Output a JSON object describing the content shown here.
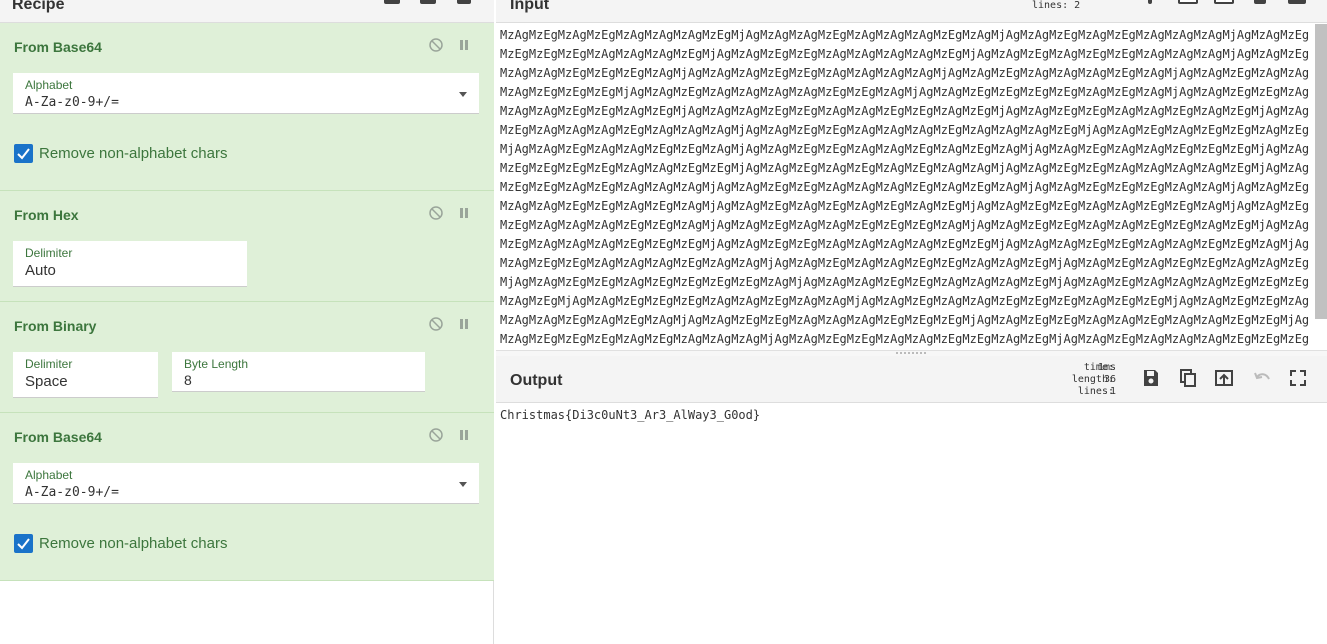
{
  "recipe": {
    "title": "Recipe",
    "operations": [
      {
        "name": "From Base64",
        "alphabet_label": "Alphabet",
        "alphabet_value": "A-Za-z0-9+/=",
        "checkbox_label": "Remove non-alphabet chars"
      },
      {
        "name": "From Hex",
        "delimiter_label": "Delimiter",
        "delimiter_value": "Auto"
      },
      {
        "name": "From Binary",
        "delimiter_label": "Delimiter",
        "delimiter_value": "Space",
        "byte_length_label": "Byte Length",
        "byte_length_value": "8"
      },
      {
        "name": "From Base64",
        "alphabet_label": "Alphabet",
        "alphabet_value": "A-Za-z0-9+/=",
        "checkbox_label": "Remove non-alphabet chars"
      }
    ]
  },
  "input": {
    "title": "Input",
    "stats": "lines:   2",
    "text": "MzAgMzEgMzAgMzEgMzAgMzAgMzAgMzEgMjAgMzAgMzAgMzEgMzAgMzAgMzAgMzEgMzAgMjAgMzAgMzEgMzAgMzEgMzAgMzAgMzAgMjAgMzAgMzEgMzEgMzEgMzEgMzAgMzAgMzAgMzEgMjAgMzAgMzEgMzEgMzAgMzAgMzAgMzAgMzEgMjAgMzAgMzEgMzAgMzEgMzEgMzAgMzAgMzAgMjAgMzAgMzEgMzAgMzAgMzEgMzEgMzEgMzAgMjAgMzAgMzAgMzEgMzEgMzAgMzAgMzAgMzAgMjAgMzAgMzEgMzAgMzAgMzAgMzEgMzAgMjAgMzAgMzEgMzAgMzAgMzAgMzEgMzEgMzEgMjAgMzAgMzEgMzAgMzAgMzAgMzAgMzEgMzEgMzAgMjAgMzAgMzEgMzEgMzEgMzEgMzAgMzEgMzAgMjAgMzAgMzEgMzEgMzAgMzAgMzAgMzEgMzEgMzAgMzEgMjAgMzAgMzAgMzEgMzEgMzAgMzAgMzEgMzEgMzAgMzEgMjAgMzAgMzEgMzEgMzAgMzAgMzEgMzAgMzEgMjAgMzAgMzEgMzAgMzAgMzAgMzEgMzAgMzAgMzAgMjAgMzAgMzEgMzEgMzAgMzAgMzAgMzEgMzAgMzAgMzAgMzEgMjAgMzAgMzEgMzAgMzEgMzEgMzAgMzEgMjAgMzAgMzEgMzAgMzAgMzEgMzEgMzAgMjAgMzAgMzEgMzEgMzAgMzAgMzEgMzAgMzEgMzAgMjAgMzAgMzEgMzAgMzAgMzEgMzEgMzEgMjAgMzAgMzEgMzEgMzEgMzEgMzAgMzAgMzEgMzEgMjAgMzAgMzEgMzAgMzEgMzAgMzEgMzAgMzAgMjAgMzAgMzEgMzEgMzAgMzAgMzAgMzAgMzEgMjAgMzAgMzEgMzEgMzAgMzEgMzAgMzAgMzAgMjAgMzAgMzEgMzEgMzAgMzAgMzAgMzEgMzAgMzEgMzAgMjAgMzAgMzEgMzEgMzEgMzAgMzAgMjAgMzAgMzEgMzAgMzAgMzEgMzEgMzAgMzEgMzAgMjAgMzAgMzEgMzAgMzEgMzAgMzEgMzAgMzEgMjAgMzAgMzEgMzEgMzAgMzAgMzEgMzEgMzAgMjAgMzAgMzEgMzEgMzAgMzAgMzAgMzEgMzEgMzAgMjAgMzAgMzEgMzAgMzAgMzEgMzEgMzEgMzAgMjAgMzAgMzEgMzEgMzAgMzAgMzEgMzEgMzAgMzEgMjAgMzAgMzEgMzAgMzAgMzAgMzEgMzEgMzEgMjAgMzAgMzEgMzEgMzAgMzAgMzAgMzAgMzEgMzEgMjAgMzAgMzAgMzEgMzEgMzAgMzAgMzEgMzEgMzAgMjAgMzAgMzEgMzEgMzAgMzAgMzAgMzEgMzAgMzAgMjAgMzAgMzEgMzAgMzAgMzEgMzEgMzAgMzAgMzEgMjAgMzAgMzEgMzAgMzEgMzEgMzAgMzAgMzEgMjAgMzAgMzEgMzEgMzAgMzEgMzEgMzEgMzEgMzAgMjAgMzAgMzAgMzEgMzEgMzAgMzAgMzAgMzEgMjAgMzAgMzEgMzAgMzAgMzAgMzEgMzEgMzEgMzAgMzEgMjAgMzAgMzEgMzEgMzEgMzAgMzAgMzEgMzAgMzAgMjAgMzAgMzEgMzAgMzAgMzEgMzEgMzEgMzAgMzEgMzEgMjAgMzAgMzEgMzEgMzAgMzAgMzAgMzEgMzAgMzEgMzAgMjAgMzAgMzEgMzEgMzAgMzAgMzAgMzEgMzEgMzEgMjAgMzAgMzEgMzEgMzAgMzAgMzEgMzAgMzAgMzEgMzEgMjAgMzAgMzEgMzEgMzEgMzAgMzEgMzAgMzAgMzAgMjAgMzAgMzEgMzEgMzAgMzAgMzEgMzEgMzAgMzEgMjAgMzAgMzEgMzAgMzAgMzAgMzEgMzEgMzEgMzAgMjAgMzAgMzEgMzEgMzAgMzAgMzAgMzEgMzEgMzAgMzEgMjAgMzAgMzEgMzAgMzAgMzEgMzEgMzEgMzAgMzAgMjAgMzAgMzEgMzEgMzAgMzAgMzEgMzAgMzAgMzEgMzAgMjAgMzAgMzEgMzEgMzEgMzAgMzEgMzEgMzAgMzAgMjAgMzAgMzEgMzAgMzAgMzEgMzEgMzAgMzEgMzEgMjAgMzAgMzEgMzEgMzAgMzAgMzAgMzEgMzAgMzAgMzAgMjAg"
  },
  "output": {
    "title": "Output",
    "stats_labels": [
      "time:",
      "length:",
      "lines:"
    ],
    "stats_values": [
      "1ms",
      "36",
      "1"
    ],
    "text": "Christmas{Di3c0uNt3_Ar3_AlWay3_G0od}"
  }
}
